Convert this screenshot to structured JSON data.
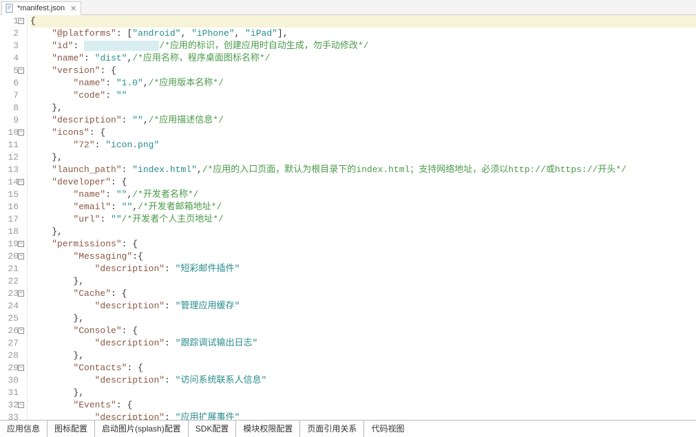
{
  "tab": {
    "title": "*manifest.json",
    "close": "✕"
  },
  "bottomTabs": [
    "应用信息",
    "图标配置",
    "启动图片(splash)配置",
    "SDK配置",
    "模块权限配置",
    "页面引用关系",
    "代码视图"
  ],
  "lines": [
    {
      "n": 1,
      "fold": "-",
      "cur": true,
      "seg": [
        [
          "brace",
          "{"
        ]
      ]
    },
    {
      "n": 2,
      "fold": "",
      "cur": false,
      "seg": [
        [
          "",
          "    "
        ],
        [
          "attr",
          "\"@platforms\""
        ],
        [
          "punct",
          ": ["
        ],
        [
          "str",
          "\"android\""
        ],
        [
          "punct",
          ", "
        ],
        [
          "str",
          "\"iPhone\""
        ],
        [
          "punct",
          ", "
        ],
        [
          "str",
          "\"iPad\""
        ],
        [
          "punct",
          "],"
        ]
      ]
    },
    {
      "n": 3,
      "fold": "",
      "cur": false,
      "seg": [
        [
          "",
          "    "
        ],
        [
          "attr",
          "\"id\""
        ],
        [
          "punct",
          ": "
        ],
        [
          "redacted",
          "\"  redacted  \""
        ],
        [
          "comment",
          "/*应用的标识，创建应用时自动生成，勿手动修改*/"
        ]
      ]
    },
    {
      "n": 4,
      "fold": "",
      "cur": false,
      "seg": [
        [
          "",
          "    "
        ],
        [
          "attr",
          "\"name\""
        ],
        [
          "punct",
          ": "
        ],
        [
          "str",
          "\"dist\""
        ],
        [
          "punct",
          ","
        ],
        [
          "comment",
          "/*应用名称，程序桌面图标名称*/"
        ]
      ]
    },
    {
      "n": 5,
      "fold": "-",
      "cur": false,
      "seg": [
        [
          "",
          "    "
        ],
        [
          "attr",
          "\"version\""
        ],
        [
          "punct",
          ": {"
        ]
      ]
    },
    {
      "n": 6,
      "fold": "",
      "cur": false,
      "seg": [
        [
          "",
          "        "
        ],
        [
          "attr",
          "\"name\""
        ],
        [
          "punct",
          ": "
        ],
        [
          "str",
          "\"1.0\""
        ],
        [
          "punct",
          ","
        ],
        [
          "comment",
          "/*应用版本名称*/"
        ]
      ]
    },
    {
      "n": 7,
      "fold": "",
      "cur": false,
      "seg": [
        [
          "",
          "        "
        ],
        [
          "attr",
          "\"code\""
        ],
        [
          "punct",
          ": "
        ],
        [
          "str",
          "\"\""
        ]
      ]
    },
    {
      "n": 8,
      "fold": "",
      "cur": false,
      "seg": [
        [
          "",
          "    "
        ],
        [
          "punct",
          "},"
        ]
      ]
    },
    {
      "n": 9,
      "fold": "",
      "cur": false,
      "seg": [
        [
          "",
          "    "
        ],
        [
          "attr",
          "\"description\""
        ],
        [
          "punct",
          ": "
        ],
        [
          "str",
          "\"\""
        ],
        [
          "punct",
          ","
        ],
        [
          "comment",
          "/*应用描述信息*/"
        ]
      ]
    },
    {
      "n": 10,
      "fold": "-",
      "cur": false,
      "seg": [
        [
          "",
          "    "
        ],
        [
          "attr",
          "\"icons\""
        ],
        [
          "punct",
          ": {"
        ]
      ]
    },
    {
      "n": 11,
      "fold": "",
      "cur": false,
      "seg": [
        [
          "",
          "        "
        ],
        [
          "attr",
          "\"72\""
        ],
        [
          "punct",
          ": "
        ],
        [
          "str",
          "\"icon.png\""
        ]
      ]
    },
    {
      "n": 12,
      "fold": "",
      "cur": false,
      "seg": [
        [
          "",
          "    "
        ],
        [
          "punct",
          "},"
        ]
      ]
    },
    {
      "n": 13,
      "fold": "",
      "cur": false,
      "seg": [
        [
          "",
          "    "
        ],
        [
          "attr",
          "\"launch_path\""
        ],
        [
          "punct",
          ": "
        ],
        [
          "str",
          "\"index.html\""
        ],
        [
          "punct",
          ","
        ],
        [
          "comment",
          "/*应用的入口页面，默认为根目录下的index.html；支持网络地址，必须以http://或https://开头*/"
        ]
      ]
    },
    {
      "n": 14,
      "fold": "-",
      "cur": false,
      "seg": [
        [
          "",
          "    "
        ],
        [
          "attr",
          "\"developer\""
        ],
        [
          "punct",
          ": {"
        ]
      ]
    },
    {
      "n": 15,
      "fold": "",
      "cur": false,
      "seg": [
        [
          "",
          "        "
        ],
        [
          "attr",
          "\"name\""
        ],
        [
          "punct",
          ": "
        ],
        [
          "str",
          "\"\""
        ],
        [
          "punct",
          ","
        ],
        [
          "comment",
          "/*开发者名称*/"
        ]
      ]
    },
    {
      "n": 16,
      "fold": "",
      "cur": false,
      "seg": [
        [
          "",
          "        "
        ],
        [
          "attr",
          "\"email\""
        ],
        [
          "punct",
          ": "
        ],
        [
          "str",
          "\"\""
        ],
        [
          "punct",
          ","
        ],
        [
          "comment",
          "/*开发者邮箱地址*/"
        ]
      ]
    },
    {
      "n": 17,
      "fold": "",
      "cur": false,
      "seg": [
        [
          "",
          "        "
        ],
        [
          "attr",
          "\"url\""
        ],
        [
          "punct",
          ": "
        ],
        [
          "str",
          "\"\""
        ],
        [
          "comment",
          "/*开发者个人主页地址*/"
        ]
      ]
    },
    {
      "n": 18,
      "fold": "",
      "cur": false,
      "seg": [
        [
          "",
          "    "
        ],
        [
          "punct",
          "},"
        ]
      ]
    },
    {
      "n": 19,
      "fold": "-",
      "cur": false,
      "seg": [
        [
          "",
          "    "
        ],
        [
          "attr",
          "\"permissions\""
        ],
        [
          "punct",
          ": {"
        ]
      ]
    },
    {
      "n": 20,
      "fold": "-",
      "cur": false,
      "seg": [
        [
          "",
          "        "
        ],
        [
          "attr",
          "\"Messaging\""
        ],
        [
          "punct",
          ":{"
        ]
      ]
    },
    {
      "n": 21,
      "fold": "",
      "cur": false,
      "seg": [
        [
          "",
          "            "
        ],
        [
          "attr",
          "\"description\""
        ],
        [
          "punct",
          ": "
        ],
        [
          "str",
          "\"短彩邮件插件\""
        ]
      ]
    },
    {
      "n": 22,
      "fold": "",
      "cur": false,
      "seg": [
        [
          "",
          "        "
        ],
        [
          "punct",
          "},"
        ]
      ]
    },
    {
      "n": 23,
      "fold": "-",
      "cur": false,
      "seg": [
        [
          "",
          "        "
        ],
        [
          "attr",
          "\"Cache\""
        ],
        [
          "punct",
          ": {"
        ]
      ]
    },
    {
      "n": 24,
      "fold": "",
      "cur": false,
      "seg": [
        [
          "",
          "            "
        ],
        [
          "attr",
          "\"description\""
        ],
        [
          "punct",
          ": "
        ],
        [
          "str",
          "\"管理应用缓存\""
        ]
      ]
    },
    {
      "n": 25,
      "fold": "",
      "cur": false,
      "seg": [
        [
          "",
          "        "
        ],
        [
          "punct",
          "},"
        ]
      ]
    },
    {
      "n": 26,
      "fold": "-",
      "cur": false,
      "seg": [
        [
          "",
          "        "
        ],
        [
          "attr",
          "\"Console\""
        ],
        [
          "punct",
          ": {"
        ]
      ]
    },
    {
      "n": 27,
      "fold": "",
      "cur": false,
      "seg": [
        [
          "",
          "            "
        ],
        [
          "attr",
          "\"description\""
        ],
        [
          "punct",
          ": "
        ],
        [
          "str",
          "\"跟踪调试输出日志\""
        ]
      ]
    },
    {
      "n": 28,
      "fold": "",
      "cur": false,
      "seg": [
        [
          "",
          "        "
        ],
        [
          "punct",
          "},"
        ]
      ]
    },
    {
      "n": 29,
      "fold": "-",
      "cur": false,
      "seg": [
        [
          "",
          "        "
        ],
        [
          "attr",
          "\"Contacts\""
        ],
        [
          "punct",
          ": {"
        ]
      ]
    },
    {
      "n": 30,
      "fold": "",
      "cur": false,
      "seg": [
        [
          "",
          "            "
        ],
        [
          "attr",
          "\"description\""
        ],
        [
          "punct",
          ": "
        ],
        [
          "str",
          "\"访问系统联系人信息\""
        ]
      ]
    },
    {
      "n": 31,
      "fold": "",
      "cur": false,
      "seg": [
        [
          "",
          "        "
        ],
        [
          "punct",
          "},"
        ]
      ]
    },
    {
      "n": 32,
      "fold": "-",
      "cur": false,
      "seg": [
        [
          "",
          "        "
        ],
        [
          "attr",
          "\"Events\""
        ],
        [
          "punct",
          ": {"
        ]
      ]
    },
    {
      "n": 33,
      "fold": "",
      "cur": false,
      "seg": [
        [
          "",
          "            "
        ],
        [
          "attr",
          "\"description\""
        ],
        [
          "punct",
          ": "
        ],
        [
          "str",
          "\"应用扩展事件\""
        ]
      ]
    }
  ]
}
